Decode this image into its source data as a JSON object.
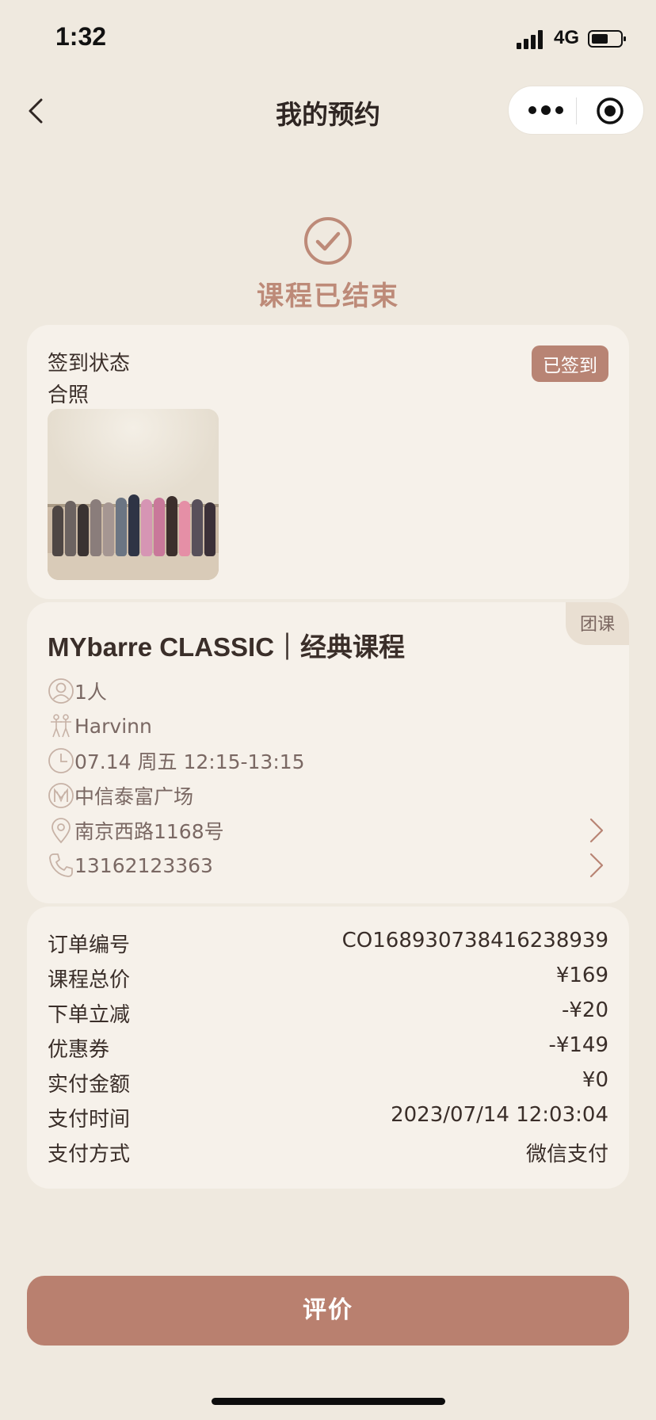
{
  "status_bar": {
    "time": "1:32",
    "network": "4G"
  },
  "nav": {
    "title": "我的预约"
  },
  "status": {
    "title": "课程已结束"
  },
  "checkin": {
    "status_label": "签到状态",
    "badge": "已签到",
    "photo_label": "合照"
  },
  "course": {
    "tag": "团课",
    "title": "MYbarre CLASSIC｜经典课程",
    "people": "1人",
    "coach": "Harvinn",
    "time": "07.14 周五 12:15-13:15",
    "venue": "中信泰富广场",
    "address": "南京西路1168号",
    "phone": "13162123363"
  },
  "order": {
    "rows": [
      {
        "label": "订单编号",
        "value": "CO16893073841623893​9"
      },
      {
        "label": "课程总价",
        "value": "¥169"
      },
      {
        "label": "下单立减",
        "value": "-¥20"
      },
      {
        "label": "优惠券",
        "value": "-¥149"
      },
      {
        "label": "实付金额",
        "value": "¥0"
      },
      {
        "label": "支付时间",
        "value": "2023/07/14 12:03:04"
      },
      {
        "label": "支付方式",
        "value": "微信支付"
      }
    ]
  },
  "review_button": "评价",
  "colors": {
    "accent": "#b9806f",
    "background": "#efe9df",
    "card": "#f6f1ea",
    "status_text": "#bd8a78"
  }
}
